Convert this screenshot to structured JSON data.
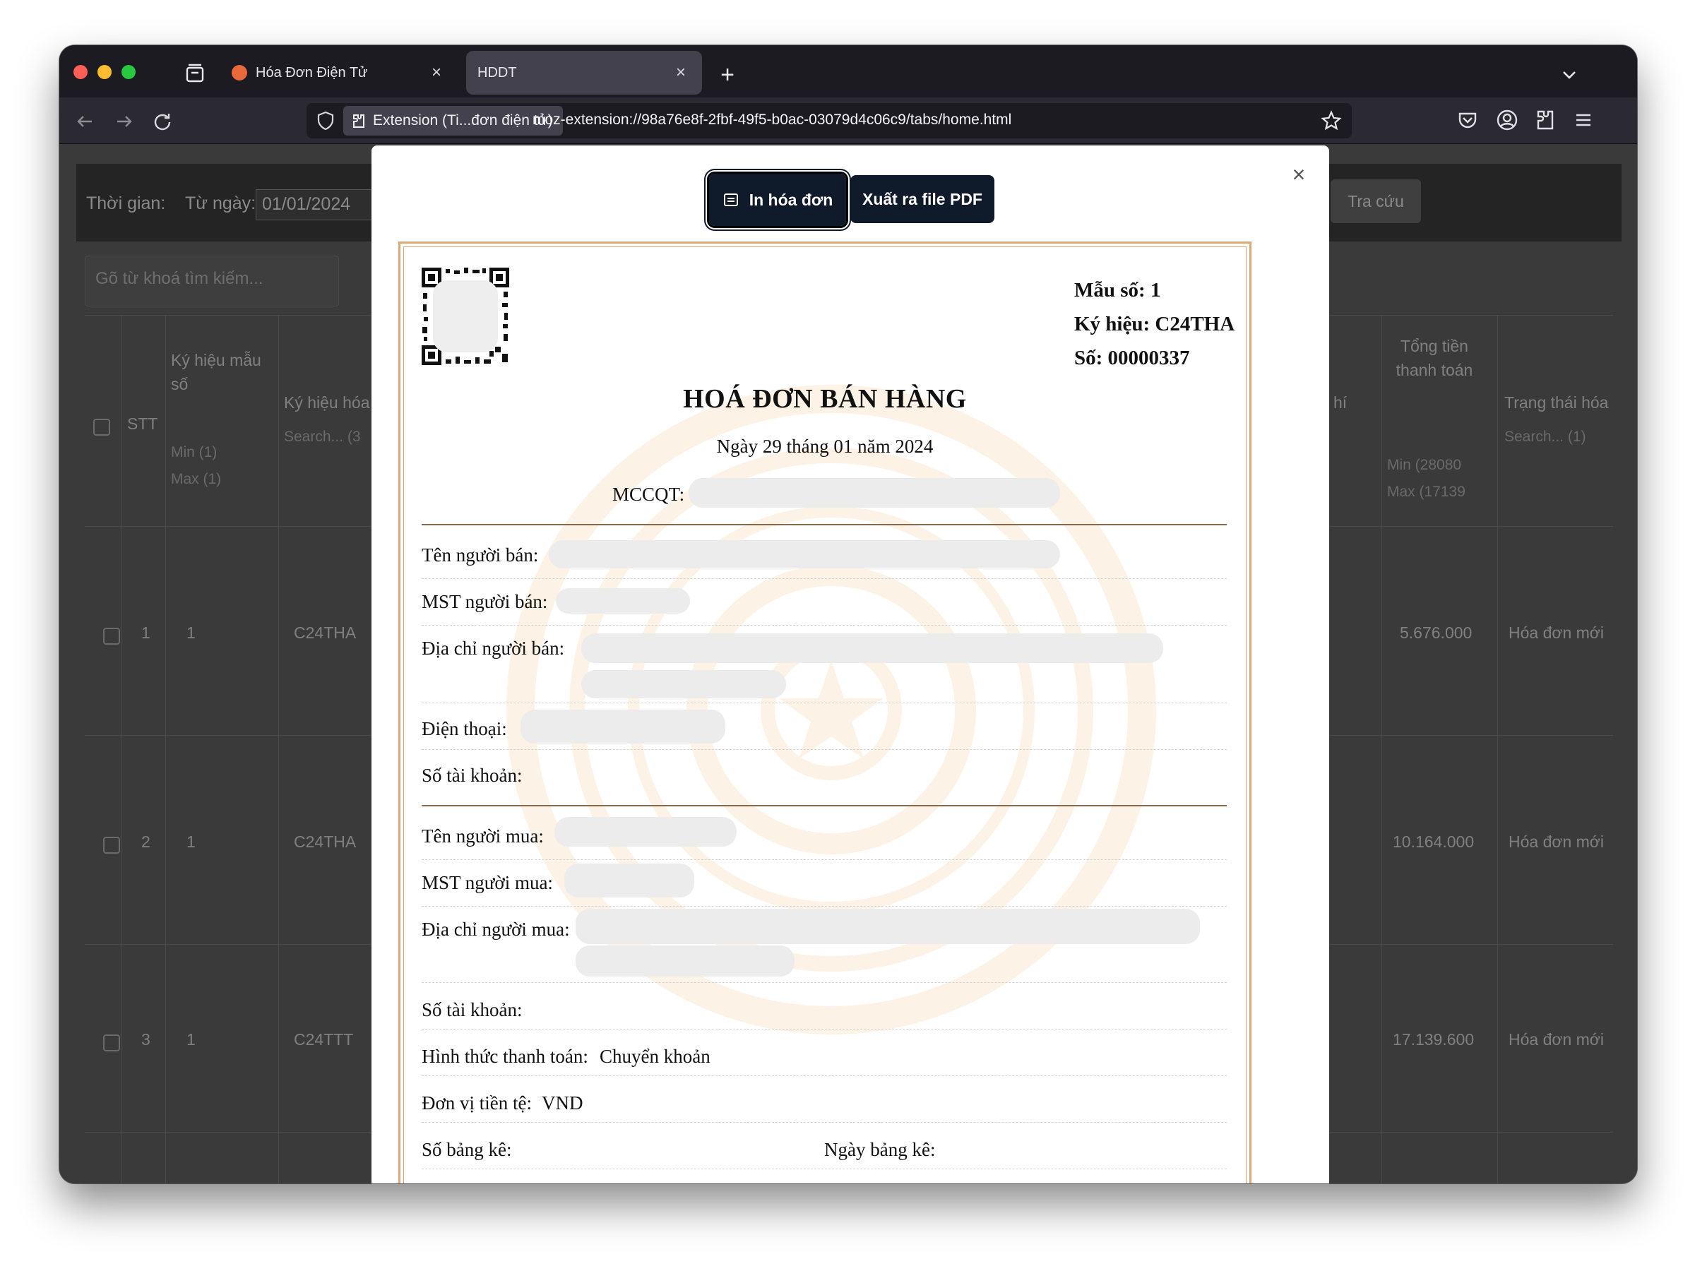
{
  "colors": {
    "traffic_red": "#fe5f57",
    "traffic_yellow": "#febc2e",
    "traffic_green": "#28c840",
    "button_dark": "#0f1a2b",
    "invoice_border": "#d9a978",
    "favicon": "#e86a3c"
  },
  "browser": {
    "tabs": [
      {
        "title": "Hóa Đơn Điện Tử",
        "icon": "site-favicon"
      },
      {
        "title": "HDDT",
        "icon": ""
      }
    ],
    "extension_label": "Extension (Ti...đơn điện tử)",
    "url": "moz-extension://98a76e8f-2fbf-49f5-b0ac-03079d4c06c9/tabs/home.html"
  },
  "background_page": {
    "filter_time_label": "Thời gian:",
    "from_date_label": "Từ ngày:",
    "from_date_value": "01/01/2024",
    "search_button": "Tra cứu",
    "search_placeholder": "Gõ từ khoá tìm kiếm...",
    "columns": {
      "stt": "STT",
      "ky_hieu_mau_so": "Ký hiệu mẫu số",
      "ky_hieu_hoa": "Ký hiệu hóa",
      "phi": "hí",
      "tong_tien": "Tổng tiền thanh toán",
      "trang_thai": "Trạng thái hóa"
    },
    "filters": {
      "min_1": "Min (1)",
      "max_1": "Max (1)",
      "search_3": "Search... (3",
      "min_tong": "Min (28080",
      "max_tong": "Max (17139",
      "search_status": "Search... (1)"
    },
    "rows": [
      {
        "stt": "1",
        "mau_so": "1",
        "ky_hieu": "C24THA",
        "tong_tien": "5.676.000",
        "trang_thai": "Hóa đơn mới"
      },
      {
        "stt": "2",
        "mau_so": "1",
        "ky_hieu": "C24THA",
        "tong_tien": "10.164.000",
        "trang_thai": "Hóa đơn mới"
      },
      {
        "stt": "3",
        "mau_so": "1",
        "ky_hieu": "C24TTT",
        "tong_tien": "17.139.600",
        "trang_thai": "Hóa đơn mới"
      }
    ]
  },
  "modal": {
    "print_button": "In hóa đơn",
    "pdf_button": "Xuất ra file PDF",
    "close": "×"
  },
  "invoice": {
    "mau_so": "Mẫu số: 1",
    "ky_hieu": "Ký hiệu: C24THA",
    "so": "Số: 00000337",
    "title": "HOÁ ĐƠN BÁN HÀNG",
    "date": "Ngày 29 tháng 01 năm 2024",
    "mccqt_label": "MCCQT:",
    "seller_name_label": "Tên người bán:",
    "seller_tax_label": "MST người bán:",
    "seller_address_label": "Địa chỉ người bán:",
    "phone_label": "Điện thoại:",
    "seller_account_label": "Số tài khoản:",
    "buyer_name_label": "Tên người mua:",
    "buyer_tax_label": "MST người mua:",
    "buyer_address_label": "Địa chỉ người mua:",
    "buyer_account_label": "Số tài khoản:",
    "payment_method_label": "Hình thức thanh toán:",
    "payment_method_value": "Chuyển khoản",
    "currency_label": "Đơn vị tiền tệ:",
    "currency_value": "VND",
    "list_no_label": "Số bảng kê:",
    "list_date_label": "Ngày bảng kê:"
  }
}
